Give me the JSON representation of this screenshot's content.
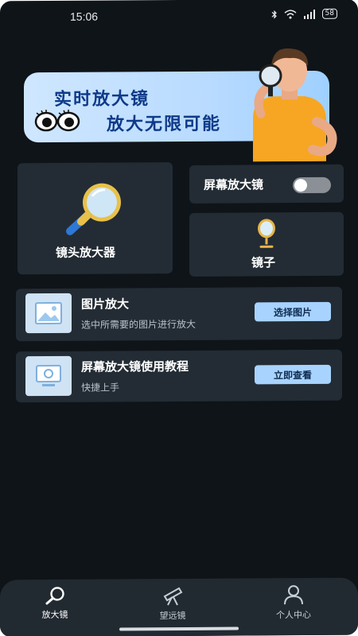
{
  "status_bar": {
    "time": "15:06",
    "battery": "58",
    "icons": [
      "bluetooth-icon",
      "wifi-icon",
      "signal-icon",
      "battery-icon"
    ]
  },
  "banner": {
    "title_line1": "实时放大镜",
    "title_line2": "放大无限可能",
    "accent_color": "#0e3a8a"
  },
  "features": {
    "lens_label": "镜头放大器",
    "screen_magnifier_label": "屏幕放大镜",
    "screen_magnifier_enabled": false,
    "mirror_label": "镜子"
  },
  "rows": {
    "picture": {
      "title": "图片放大",
      "subtitle": "选中所需要的图片进行放大",
      "button": "选择图片"
    },
    "tutorial": {
      "title": "屏幕放大镜使用教程",
      "subtitle": "快捷上手",
      "button": "立即查看"
    }
  },
  "tabs": [
    {
      "label": "放大镜",
      "icon": "magnifier-icon",
      "active": true
    },
    {
      "label": "望远镜",
      "icon": "telescope-icon",
      "active": false
    },
    {
      "label": "个人中心",
      "icon": "user-icon",
      "active": false
    }
  ]
}
